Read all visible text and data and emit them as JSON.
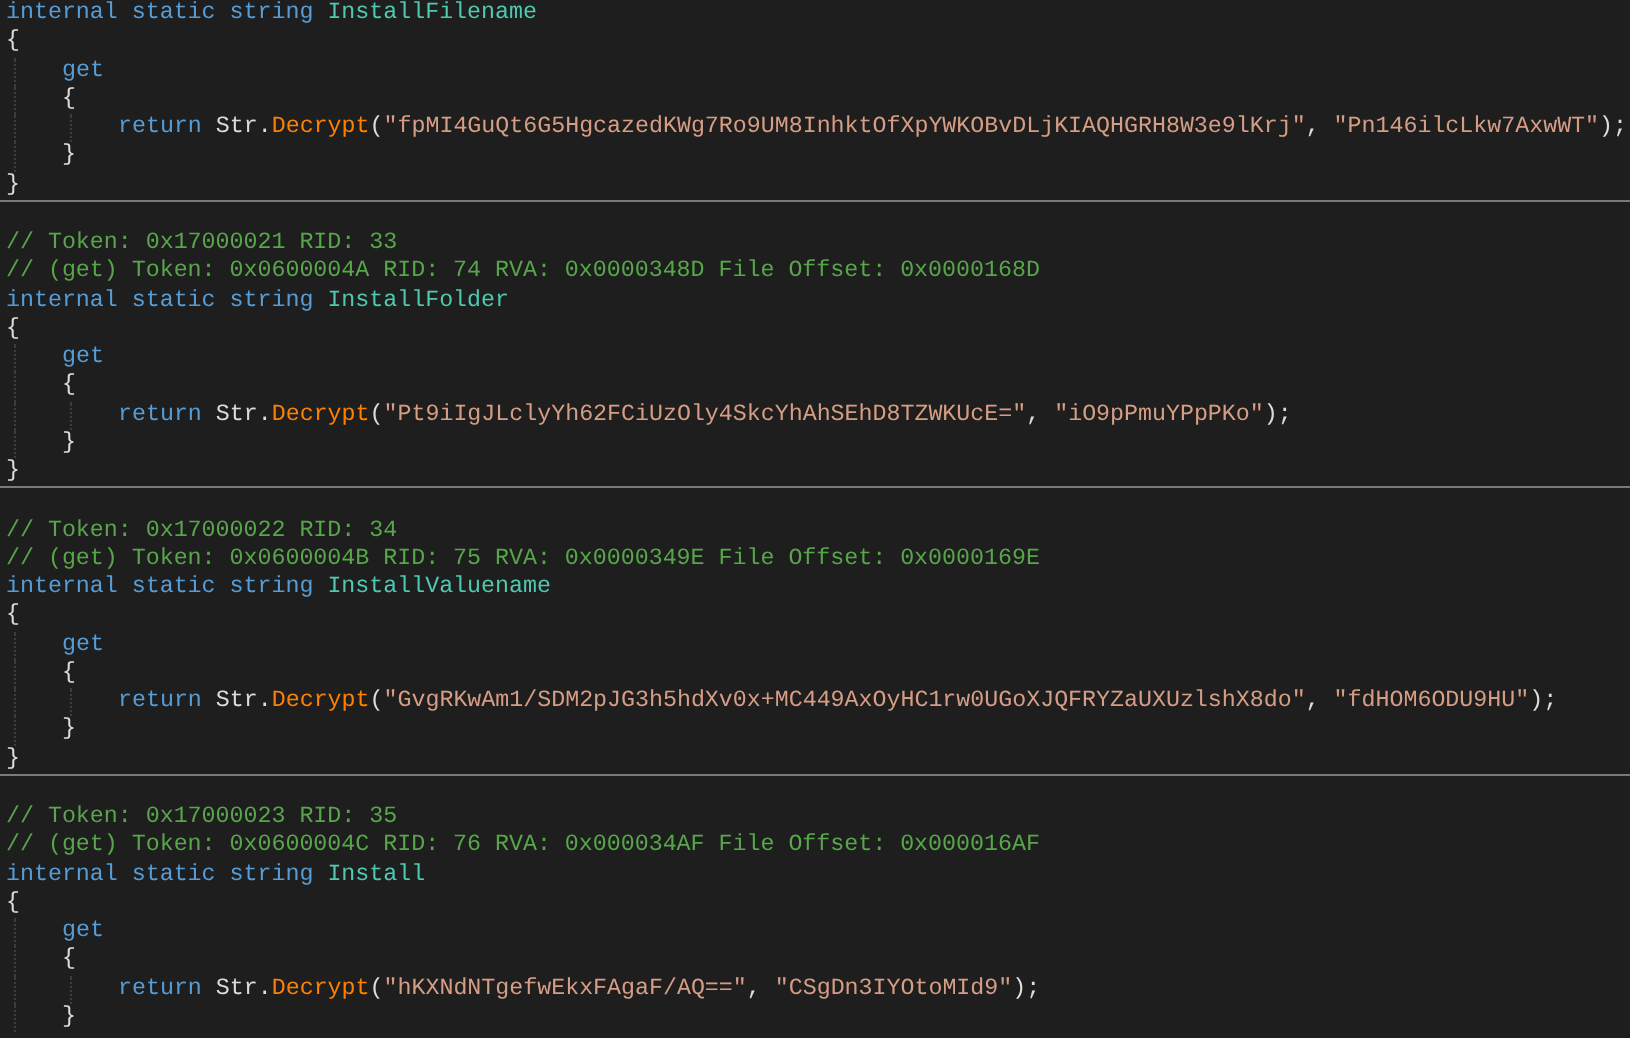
{
  "blocks": [
    {
      "modifiers": "internal static string",
      "name": "InstallFilename",
      "accessor": "get",
      "call": {
        "keyword": "return",
        "object": "Str",
        "method": "Decrypt",
        "args": [
          "\"fpMI4GuQt6G5HgcazedKWg7Ro9UM8InhktOfXpYWKOBvDLjKIAQHGRH8W3e9lKrj\"",
          "\"Pn146ilcLkw7AxwWT\""
        ]
      },
      "closing_brace": true,
      "separator": true
    },
    {
      "comments": [
        "// Token: 0x17000021 RID: 33",
        "// (get) Token: 0x0600004A RID: 74 RVA: 0x0000348D File Offset: 0x0000168D"
      ],
      "modifiers": "internal static string",
      "name": "InstallFolder",
      "accessor": "get",
      "call": {
        "keyword": "return",
        "object": "Str",
        "method": "Decrypt",
        "args": [
          "\"Pt9iIgJLclyYh62FCiUzOly4SkcYhAhSEhD8TZWKUcE=\"",
          "\"iO9pPmuYPpPKo\""
        ]
      },
      "closing_brace": true,
      "separator": true
    },
    {
      "comments": [
        "// Token: 0x17000022 RID: 34",
        "// (get) Token: 0x0600004B RID: 75 RVA: 0x0000349E File Offset: 0x0000169E"
      ],
      "modifiers": "internal static string",
      "name": "InstallValuename",
      "accessor": "get",
      "call": {
        "keyword": "return",
        "object": "Str",
        "method": "Decrypt",
        "args": [
          "\"GvgRKwAm1/SDM2pJG3h5hdXv0x+MC449AxOyHC1rw0UGoXJQFRYZaUXUzlshX8do\"",
          "\"fdHOM6ODU9HU\""
        ]
      },
      "closing_brace": true,
      "separator": true
    },
    {
      "comments": [
        "// Token: 0x17000023 RID: 35",
        "// (get) Token: 0x0600004C RID: 76 RVA: 0x000034AF File Offset: 0x000016AF"
      ],
      "modifiers": "internal static string",
      "name": "Install",
      "accessor": "get",
      "call": {
        "keyword": "return",
        "object": "Str",
        "method": "Decrypt",
        "args": [
          "\"hKXNdNTgefwEkxFAgaF/AQ==\"",
          "\"CSgDn3IYOtoMId9\""
        ]
      },
      "closing_brace": false,
      "separator": false
    }
  ],
  "punctuation": {
    "open": "{",
    "close": "}",
    "dot": ".",
    "lparen": "(",
    "comma": ", ",
    "rparen_semi": ");"
  }
}
